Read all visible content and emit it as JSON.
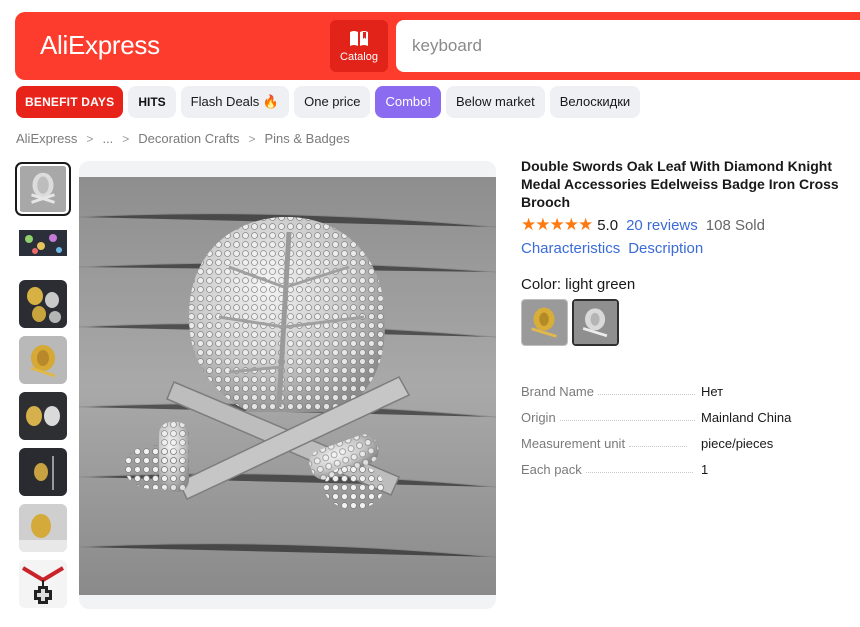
{
  "header": {
    "logo": "AliExpress",
    "catalog_label": "Catalog",
    "search_placeholder": "keyboard"
  },
  "promo_pills": [
    {
      "label": "BENEFIT DAYS"
    },
    {
      "label": "HITS"
    },
    {
      "label": "Flash Deals"
    },
    {
      "label": "One price"
    },
    {
      "label": "Combo!"
    },
    {
      "label": "Below market"
    },
    {
      "label": "Велоскидки"
    }
  ],
  "breadcrumb": [
    "AliExpress",
    "...",
    "Decoration Crafts",
    "Pins & Badges"
  ],
  "product": {
    "title": "Double Swords Oak Leaf With Diamond Knight Medal Accessories Edelweiss Badge Iron Cross Brooch",
    "rating": "5.0",
    "stars": 5,
    "reviews": "20 reviews",
    "sold": "108 Sold",
    "links": [
      "Characteristics",
      "Description"
    ],
    "color_label": "Color: light green",
    "specs": [
      {
        "key": "Brand Name",
        "value": "Нет"
      },
      {
        "key": "Origin",
        "value": "Mainland China"
      },
      {
        "key": "Measurement unit",
        "value": "piece/pieces"
      },
      {
        "key": "Each pack",
        "value": "1"
      }
    ]
  },
  "colors": {
    "brand": "#fd3c2d",
    "link": "#3a6bd6",
    "star": "#fd7a12",
    "combo": "#8b6cf0"
  }
}
